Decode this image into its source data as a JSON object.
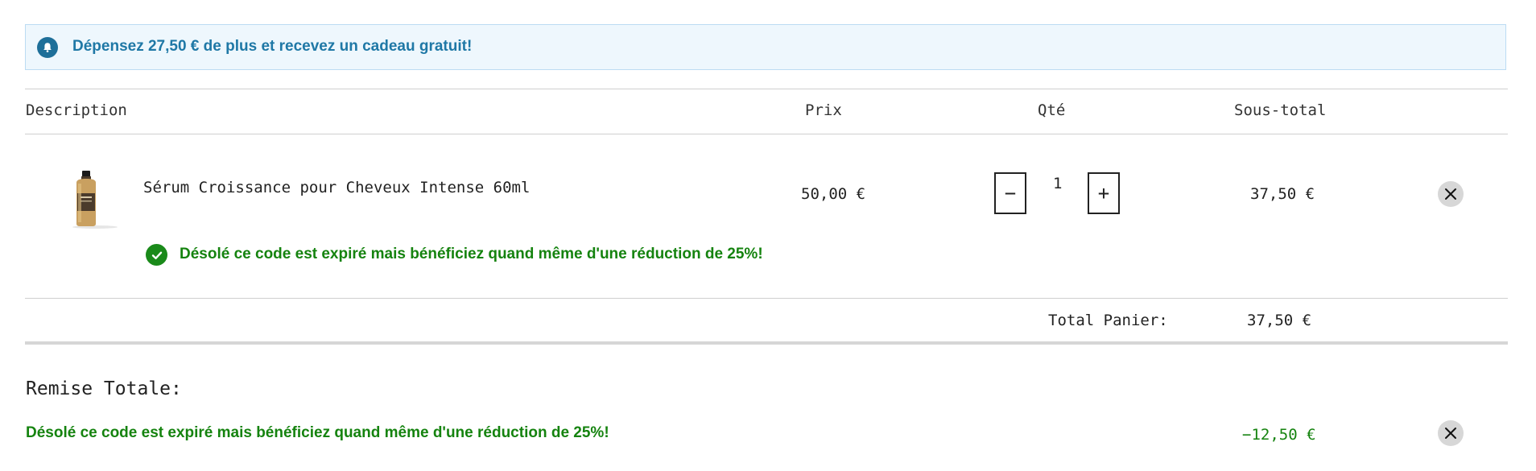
{
  "banner": {
    "message": "Dépensez 27,50 € de plus et recevez un cadeau gratuit!",
    "icon": "bell-icon",
    "color": "#1f78a6"
  },
  "table": {
    "headers": {
      "description": "Description",
      "price": "Prix",
      "quantity": "Qté",
      "subtotal": "Sous-total"
    }
  },
  "item": {
    "name": "Sérum Croissance pour Cheveux Intense 60ml",
    "price": "50,00 €",
    "quantity": "1",
    "subtotal": "37,50 €",
    "decrement_label": "−",
    "increment_label": "+",
    "discount_message": "Désolé ce code est expiré mais bénéficiez quand même d'une réduction de 25%!"
  },
  "cart_total": {
    "label": "Total Panier:",
    "value": "37,50 €"
  },
  "discount": {
    "heading": "Remise Totale:",
    "message": "Désolé ce code est expiré mais bénéficiez quand même d'une réduction de 25%!",
    "amount": "−12,50 €",
    "color": "#15830f"
  }
}
